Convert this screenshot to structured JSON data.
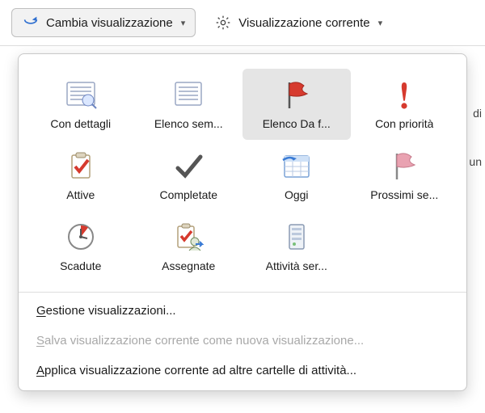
{
  "toolbar": {
    "changeView": "Cambia visualizzazione",
    "currentView": "Visualizzazione corrente"
  },
  "views": [
    {
      "key": "detailed",
      "label": "Con dettagli"
    },
    {
      "key": "simple",
      "label": "Elenco sem..."
    },
    {
      "key": "todo",
      "label": "Elenco Da f..."
    },
    {
      "key": "priority",
      "label": "Con priorità"
    },
    {
      "key": "active",
      "label": "Attive"
    },
    {
      "key": "completed",
      "label": "Completate"
    },
    {
      "key": "today",
      "label": "Oggi"
    },
    {
      "key": "next7",
      "label": "Prossimi se..."
    },
    {
      "key": "overdue",
      "label": "Scadute"
    },
    {
      "key": "assigned",
      "label": "Assegnate"
    },
    {
      "key": "server",
      "label": "Attività ser..."
    }
  ],
  "menu": {
    "manage": {
      "pre": "G",
      "rest": "estione visualizzazioni..."
    },
    "save": {
      "pre": "S",
      "rest": "alva visualizzazione corrente come nuova visualizzazione..."
    },
    "apply": {
      "pre": "A",
      "rest": "pplica visualizzazione corrente ad altre cartelle di attività..."
    }
  },
  "bg": {
    "frag1": "di",
    "frag2": "un"
  }
}
